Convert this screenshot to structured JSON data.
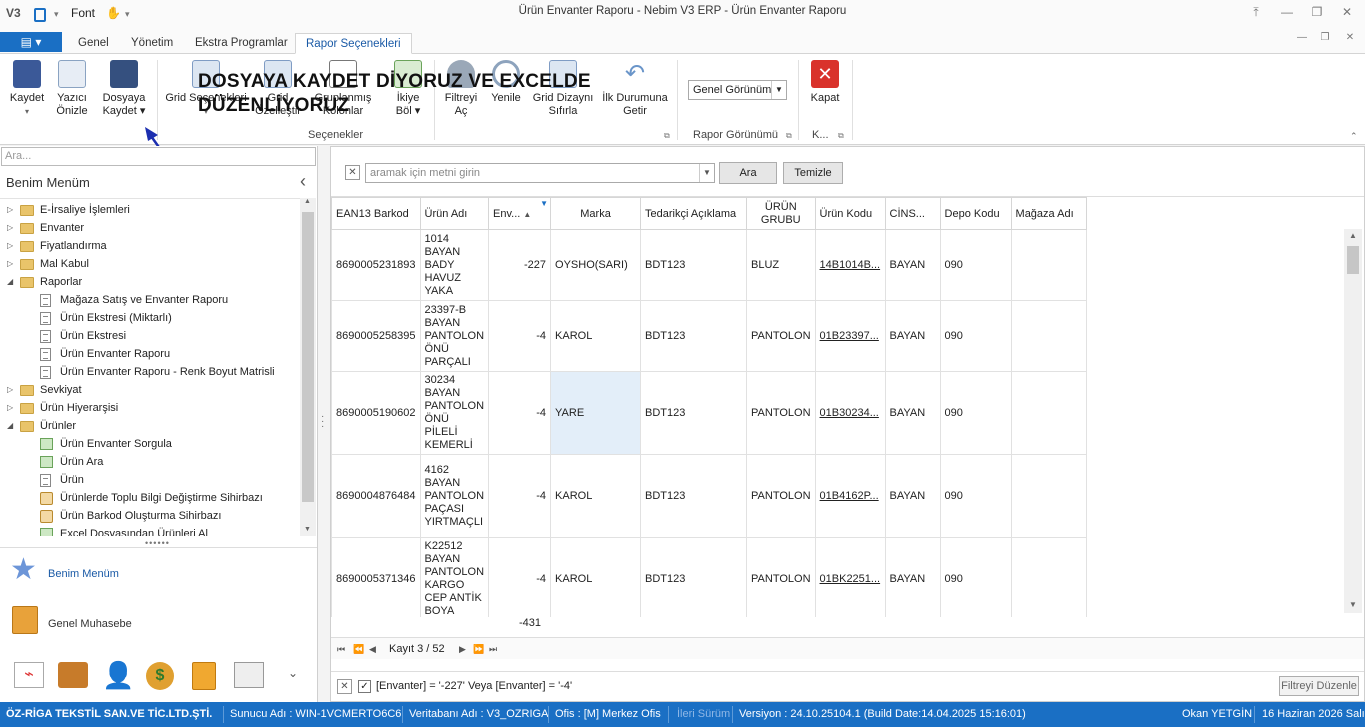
{
  "window": {
    "title": "Ürün Envanter Raporu - Nebim V3 ERP - Ürün Envanter Raporu",
    "quick_access_font": "Font"
  },
  "tabs": [
    "Genel",
    "Yönetim",
    "Ekstra Programlar",
    "Rapor Seçenekleri"
  ],
  "ribbon": {
    "buttons": [
      {
        "line1": "Kaydet",
        "line2": "▾"
      },
      {
        "line1": "Yazıcı",
        "line2": "Önizle"
      },
      {
        "line1": "Dosyaya",
        "line2": "Kaydet ▾"
      },
      {
        "line1": "Grid Seçenekleri",
        "line2": "▾"
      },
      {
        "line1": "Grid",
        "line2": "Özelleştir"
      },
      {
        "line1": "Gruplanmış",
        "line2": "Kolonlar"
      },
      {
        "line1": "İkiye",
        "line2": "Böl ▾"
      },
      {
        "line1": "Filtreyi",
        "line2": "Aç"
      },
      {
        "line1": "Yenile",
        "line2": ""
      },
      {
        "line1": "Grid Dizaynı",
        "line2": "Sıfırla"
      },
      {
        "line1": "İlk Durumuna",
        "line2": "Getir"
      }
    ],
    "group_secenekler": "Seçenekler",
    "view_select": "Genel Görünüm",
    "group_rapor_gorunumu": "Rapor Görünümü",
    "close_label": "Kapat",
    "group_k": "K..."
  },
  "annotation": {
    "line1": "DOSYAYA KAYDET DİYORUZ VE EXCELDE",
    "line2": "DÜZENLİYORUZ"
  },
  "left": {
    "search_placeholder": "Ara...",
    "menu_title": "Benim Menüm",
    "collapse_glyph": "‹",
    "tree": [
      {
        "label": "E-İrsaliye İşlemleri",
        "level": 0,
        "expanded": false,
        "kind": "folder"
      },
      {
        "label": "Envanter",
        "level": 0,
        "expanded": false,
        "kind": "folder"
      },
      {
        "label": "Fiyatlandırma",
        "level": 0,
        "expanded": false,
        "kind": "folder"
      },
      {
        "label": "Mal Kabul",
        "level": 0,
        "expanded": false,
        "kind": "folder"
      },
      {
        "label": "Raporlar",
        "level": 0,
        "expanded": true,
        "kind": "folder"
      },
      {
        "label": "Mağaza Satış ve Envanter Raporu",
        "level": 1,
        "kind": "doc"
      },
      {
        "label": "Ürün Ekstresi (Miktarlı)",
        "level": 1,
        "kind": "doc"
      },
      {
        "label": "Ürün Ekstresi",
        "level": 1,
        "kind": "doc"
      },
      {
        "label": "Ürün Envanter Raporu",
        "level": 1,
        "kind": "doc"
      },
      {
        "label": "Ürün Envanter Raporu - Renk Boyut Matrisli",
        "level": 1,
        "kind": "doc"
      },
      {
        "label": "Sevkiyat",
        "level": 0,
        "expanded": false,
        "kind": "folder"
      },
      {
        "label": "Ürün Hiyerarşisi",
        "level": 0,
        "expanded": false,
        "kind": "folder"
      },
      {
        "label": "Ürünler",
        "level": 0,
        "expanded": true,
        "kind": "folder"
      },
      {
        "label": "Ürün Envanter Sorgula",
        "level": 1,
        "kind": "grid"
      },
      {
        "label": "Ürün Ara",
        "level": 1,
        "kind": "grid"
      },
      {
        "label": "Ürün",
        "level": 1,
        "kind": "doc"
      },
      {
        "label": "Ürünlerde Toplu Bilgi Değiştirme Sihirbazı",
        "level": 1,
        "kind": "wizard"
      },
      {
        "label": "Ürün Barkod Oluşturma Sihirbazı",
        "level": 1,
        "kind": "wizard"
      },
      {
        "label": "Excel Dosyasından Ürünleri Al",
        "level": 1,
        "kind": "grid"
      }
    ],
    "nav": {
      "benim_menum": "Benim Menüm",
      "genel_muhasebe": "Genel Muhasebe"
    }
  },
  "grid": {
    "search_placeholder": "aramak için metni girin",
    "find_button": "Ara",
    "clear_button": "Temizle",
    "columns": [
      "EAN13 Barkod",
      "Ürün Adı",
      "Env...",
      "Marka",
      "Tedarikçi Açıklama",
      "ÜRÜN GRUBU",
      "Ürün Kodu",
      "CİNS...",
      "Depo Kodu",
      "Mağaza Adı"
    ],
    "rows": [
      {
        "barcode": "8690005231893",
        "name": "1014 BAYAN BADY HAVUZ YAKA",
        "env": "-227",
        "marka": "OYSHO(SARI)",
        "ted": "BDT123",
        "grup": "BLUZ",
        "kod": "14B1014B...",
        "cins": "BAYAN",
        "depo": "090",
        "magaza": ""
      },
      {
        "barcode": "8690005258395",
        "name": "23397-B BAYAN PANTOLON ÖNÜ PARÇALI",
        "env": "-4",
        "marka": "KAROL",
        "ted": "BDT123",
        "grup": "PANTOLON",
        "kod": "01B23397...",
        "cins": "BAYAN",
        "depo": "090",
        "magaza": ""
      },
      {
        "barcode": "8690005190602",
        "name": "30234 BAYAN PANTOLON ÖNÜ PİLELİ KEMERLİ",
        "env": "-4",
        "marka": "YARE",
        "ted": "BDT123",
        "grup": "PANTOLON",
        "kod": "01B30234...",
        "cins": "BAYAN",
        "depo": "090",
        "magaza": ""
      },
      {
        "barcode": "8690004876484",
        "name": "4162 BAYAN PANTOLON PAÇASI YIRTMAÇLI",
        "env": "-4",
        "marka": "KAROL",
        "ted": "BDT123",
        "grup": "PANTOLON",
        "kod": "01B4162P...",
        "cins": "BAYAN",
        "depo": "090",
        "magaza": ""
      },
      {
        "barcode": "8690005371346",
        "name": "K22512 BAYAN PANTOLON KARGO CEP ANTİK BOYA",
        "env": "-4",
        "marka": "KAROL",
        "ted": "BDT123",
        "grup": "PANTOLON",
        "kod": "01BK2251...",
        "cins": "BAYAN",
        "depo": "090",
        "magaza": ""
      }
    ],
    "total": "-431",
    "pager_text": "Kayıt 3 / 52",
    "filter_text": "[Envanter] = '-227' Veya [Envanter] = '-4'",
    "filter_edit_button": "Filtreyi Düzenle"
  },
  "status": {
    "company": "ÖZ-RİGA TEKSTİL SAN.VE TİC.LTD.ŞTİ.",
    "server": "Sunucu Adı : WIN-1VCMERTO6C6",
    "db": "Veritabanı Adı : V3_OZRIGA",
    "office": "Ofis : [M]  Merkez Ofis",
    "later": "İleri Sürüm",
    "version": "Versiyon : 24.10.25104.1 (Build Date:14.04.2025 15:16:01)",
    "user": "Okan YETGİN",
    "date": "16 Haziran 2026 Salı"
  },
  "colors": {
    "accent": "#1a6fc4",
    "annotation_arrow": "#1c2fb0",
    "link": "#1a62b8",
    "close_red": "#d9322b"
  }
}
